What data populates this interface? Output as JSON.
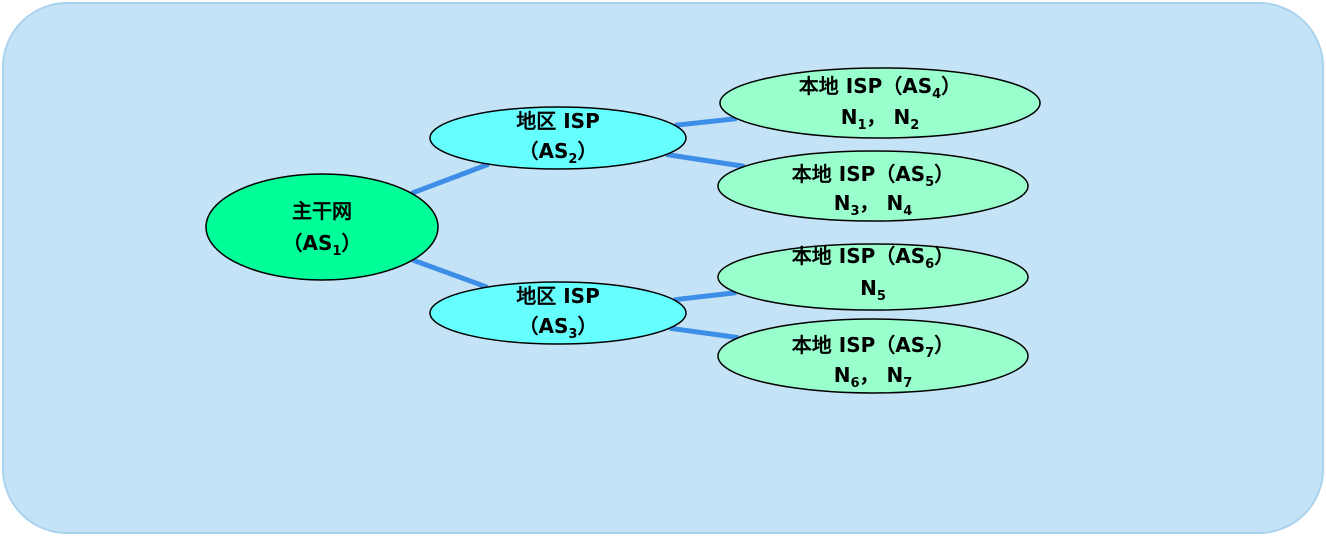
{
  "colors": {
    "panel_fill": "#c5e3f7",
    "panel_stroke": "#a9d2ef",
    "link": "#3d8ee6",
    "backbone_fill": "#00ff99",
    "regional_fill": "#66ffff",
    "local_fill": "#99ffcc",
    "node_stroke": "#000000"
  },
  "nodes": {
    "backbone": {
      "line1": [
        {
          "t": "主干网"
        }
      ],
      "line2": [
        {
          "t": "（AS"
        },
        {
          "t": "1",
          "sub": true
        },
        {
          "t": "）"
        }
      ]
    },
    "region_a": {
      "line1": [
        {
          "t": "地区 ISP"
        }
      ],
      "line2": [
        {
          "t": "（AS"
        },
        {
          "t": "2",
          "sub": true
        },
        {
          "t": "）"
        }
      ]
    },
    "region_b": {
      "line1": [
        {
          "t": "地区 ISP"
        }
      ],
      "line2": [
        {
          "t": "（AS"
        },
        {
          "t": "3",
          "sub": true
        },
        {
          "t": "）"
        }
      ]
    },
    "local_4": {
      "line1": [
        {
          "t": "本地 ISP（AS"
        },
        {
          "t": "4",
          "sub": true
        },
        {
          "t": "）"
        }
      ],
      "line2": [
        {
          "t": "N"
        },
        {
          "t": "1",
          "sub": true
        },
        {
          "t": "， N"
        },
        {
          "t": "2",
          "sub": true
        }
      ]
    },
    "local_5": {
      "line1": [
        {
          "t": "本地 ISP（AS"
        },
        {
          "t": "5",
          "sub": true
        },
        {
          "t": "）"
        }
      ],
      "line2": [
        {
          "t": "N"
        },
        {
          "t": "3",
          "sub": true
        },
        {
          "t": "， N"
        },
        {
          "t": "4",
          "sub": true
        }
      ]
    },
    "local_6": {
      "line1": [
        {
          "t": "本地 ISP（AS"
        },
        {
          "t": "6",
          "sub": true
        },
        {
          "t": "）"
        }
      ],
      "line2": [
        {
          "t": "N"
        },
        {
          "t": "5",
          "sub": true
        }
      ]
    },
    "local_7": {
      "line1": [
        {
          "t": "本地 ISP（AS"
        },
        {
          "t": "7",
          "sub": true
        },
        {
          "t": "）"
        }
      ],
      "line2": [
        {
          "t": "N"
        },
        {
          "t": "6",
          "sub": true
        },
        {
          "t": "， N"
        },
        {
          "t": "7",
          "sub": true
        }
      ]
    }
  },
  "links": [
    {
      "from": "backbone",
      "to": "region_a"
    },
    {
      "from": "backbone",
      "to": "region_b"
    },
    {
      "from": "region_a",
      "to": "local_4"
    },
    {
      "from": "region_a",
      "to": "local_5"
    },
    {
      "from": "region_b",
      "to": "local_6"
    },
    {
      "from": "region_b",
      "to": "local_7"
    }
  ]
}
